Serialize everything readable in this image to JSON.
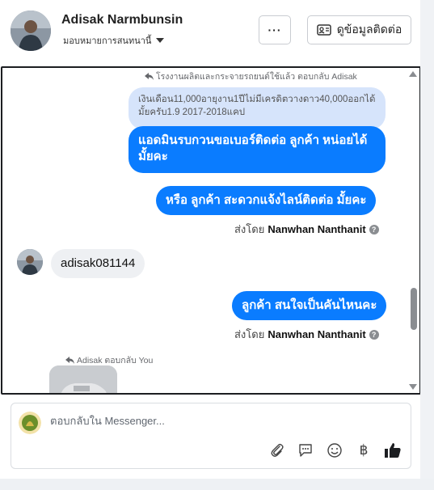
{
  "header": {
    "user_name": "Adisak Narmbunsin",
    "assignee_label": "มอบหมายการสนทนานี้",
    "more_label": "···",
    "contact_info_label": "ดูข้อมูลติดต่อ"
  },
  "thread": {
    "reply_hint_top": "โรงงานผลิตและกระจายรถยนต์ใช้แล้ว ตอบกลับ Adisak",
    "quoted_text": "เงินเดือน11,000อายุงาน1ปีไม่มีเครดิตวางดาว40,000ออกได้มั้ยครับ1.9 2017-2018แคป",
    "messages": [
      {
        "text": "แอดมินรบกวนขอเบอร์ติดต่อ ลูกค้า  หน่อยได้มั้ยคะ"
      },
      {
        "text": "หรือ ลูกค้า   สะดวกแจ้งไลน์ติดต่อ มั้ยคะ"
      },
      {
        "text": "adisak081144"
      },
      {
        "text": "ลูกค้า สนใจเป็นคันไหนคะ"
      }
    ],
    "sent_by_prefix": "ส่งโดย",
    "sent_by_name": "Nanwhan Nanthanit",
    "reply_hint_bottom": "Adisak ตอบกลับ You"
  },
  "composer": {
    "placeholder": "ตอบกลับใน Messenger...",
    "baht_symbol": "฿"
  },
  "colors": {
    "accent": "#0a7cff",
    "quoted_bg": "#d6e4fb",
    "incoming_bg": "#eef0f3"
  },
  "icons": [
    "avatar",
    "caret-down-icon",
    "more-icon",
    "contact-card-icon",
    "reply-arrow-icon",
    "help-icon",
    "attachment-icon",
    "saved-reply-icon",
    "emoji-icon",
    "baht-icon",
    "like-icon",
    "scroll-up-icon",
    "scroll-down-icon"
  ]
}
